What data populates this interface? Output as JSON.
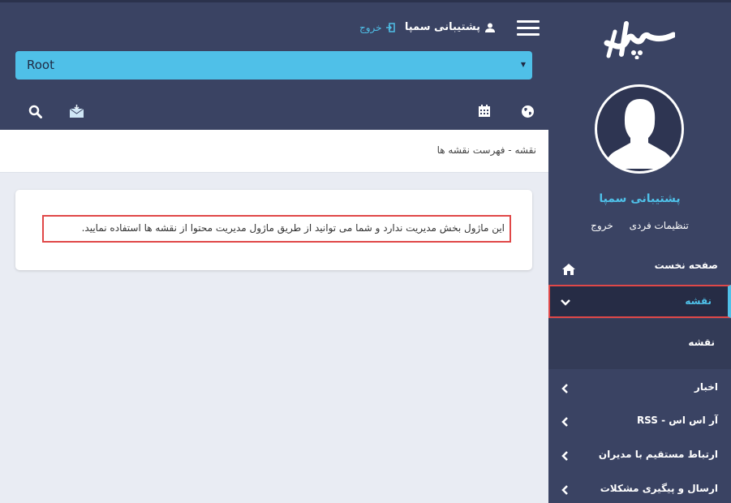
{
  "header": {
    "user_name": "پشتیبانی سمپا",
    "logout_label": "خروج",
    "root_select_value": "Root"
  },
  "breadcrumb": "نقشه - فهرست نقشه ها",
  "notice": "این ماژول بخش مدیریت ندارد و شما می توانید از طریق ماژول مدیریت محتوا از نقشه ها استفاده نمایید.",
  "sidebar": {
    "username": "پشتیبانی سمپا",
    "settings_label": "تنظیمات فردی",
    "logout_label": "خروج",
    "menu": {
      "home": "صفحه نخست",
      "map": "نقشه",
      "map_sub": "نقشه",
      "news": "اخبار",
      "rss": "آر اس اس - RSS",
      "direct_contact": "ارتباط مستقیم با مدیران",
      "issues": "ارسال و پیگیری مشکلات"
    }
  },
  "colors": {
    "header_bg": "#3a4363",
    "accent": "#4fc0e8",
    "highlight_border": "#e04848",
    "active_menu_bg": "#262c45"
  },
  "icons": [
    "hamburger-icon",
    "user-icon",
    "logout-icon",
    "globe-icon",
    "calendar-icon",
    "mail-icon",
    "search-icon",
    "home-icon",
    "chevron-icon"
  ]
}
